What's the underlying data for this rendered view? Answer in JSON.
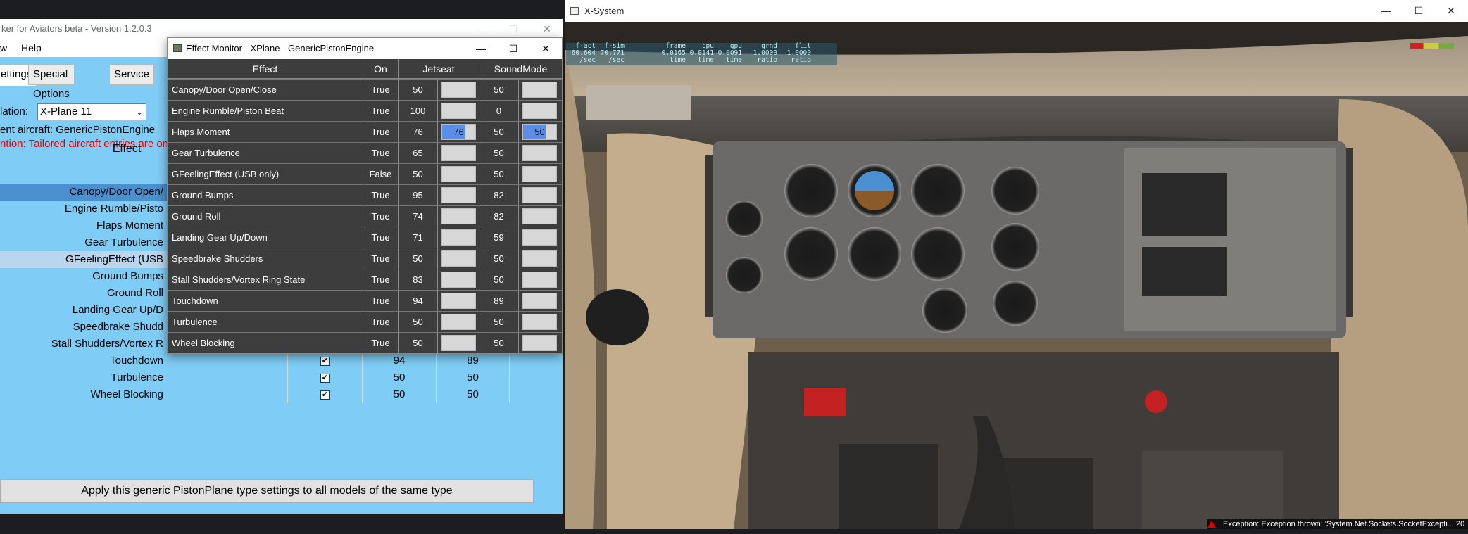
{
  "background_window": {
    "title": "ker for Aviators beta  - Version 1.2.0.3",
    "menu": [
      "w",
      "Help"
    ],
    "tabs": [
      "ettings",
      "Special Options",
      "Service"
    ],
    "sim_label": "lation:",
    "sim_value": "X-Plane 11",
    "aircraft_label": "ent aircraft: GenericPistonEngine",
    "notice": "ntion: Tailored aircraft entries are onl",
    "effect_header": "Effect",
    "rows": [
      {
        "name": "Canopy/Door Open/",
        "on": "",
        "j": "",
        "s": ""
      },
      {
        "name": "Engine Rumble/Pisto",
        "on": "",
        "j": "",
        "s": ""
      },
      {
        "name": "Flaps Moment",
        "on": "",
        "j": "",
        "s": ""
      },
      {
        "name": "Gear Turbulence",
        "on": "",
        "j": "",
        "s": ""
      },
      {
        "name": "GFeelingEffect (USB",
        "on": "",
        "j": "",
        "s": ""
      },
      {
        "name": "Ground Bumps",
        "on": "",
        "j": "",
        "s": ""
      },
      {
        "name": "Ground Roll",
        "on": "",
        "j": "",
        "s": ""
      },
      {
        "name": "Landing Gear Up/D",
        "on": "",
        "j": "",
        "s": ""
      },
      {
        "name": "Speedbrake Shudd",
        "on": "",
        "j": "",
        "s": ""
      },
      {
        "name": "Stall Shudders/Vortex R",
        "on": "",
        "j": "",
        "s": ""
      },
      {
        "name": "Touchdown",
        "on": "✔",
        "j": "94",
        "s": "89"
      },
      {
        "name": "Turbulence",
        "on": "✔",
        "j": "50",
        "s": "50"
      },
      {
        "name": "Wheel Blocking",
        "on": "✔",
        "j": "50",
        "s": "50"
      }
    ],
    "apply_label": "Apply this generic PistonPlane type settings to all models of the same type"
  },
  "effect_monitor": {
    "title": "Effect Monitor - XPlane - GenericPistonEngine",
    "headers": {
      "effect": "Effect",
      "on": "On",
      "jetseat": "Jetseat",
      "soundmode": "SoundMode"
    },
    "rows": [
      {
        "effect": "Canopy/Door Open/Close",
        "on": "True",
        "jetseat": "50",
        "jetseat_bar": "",
        "sound": "50",
        "sound_bar": ""
      },
      {
        "effect": "Engine Rumble/Piston Beat",
        "on": "True",
        "jetseat": "100",
        "jetseat_bar": "",
        "sound": "0",
        "sound_bar": ""
      },
      {
        "effect": "Flaps Moment",
        "on": "True",
        "jetseat": "76",
        "jetseat_bar": "76",
        "sound": "50",
        "sound_bar": "50"
      },
      {
        "effect": "Gear Turbulence",
        "on": "True",
        "jetseat": "65",
        "jetseat_bar": "",
        "sound": "50",
        "sound_bar": ""
      },
      {
        "effect": "GFeelingEffect (USB only)",
        "on": "False",
        "jetseat": "50",
        "jetseat_bar": "",
        "sound": "50",
        "sound_bar": ""
      },
      {
        "effect": "Ground Bumps",
        "on": "True",
        "jetseat": "95",
        "jetseat_bar": "",
        "sound": "82",
        "sound_bar": ""
      },
      {
        "effect": "Ground Roll",
        "on": "True",
        "jetseat": "74",
        "jetseat_bar": "",
        "sound": "82",
        "sound_bar": ""
      },
      {
        "effect": "Landing Gear Up/Down",
        "on": "True",
        "jetseat": "71",
        "jetseat_bar": "",
        "sound": "59",
        "sound_bar": ""
      },
      {
        "effect": "Speedbrake Shudders",
        "on": "True",
        "jetseat": "50",
        "jetseat_bar": "",
        "sound": "50",
        "sound_bar": ""
      },
      {
        "effect": "Stall Shudders/Vortex Ring State",
        "on": "True",
        "jetseat": "83",
        "jetseat_bar": "",
        "sound": "50",
        "sound_bar": ""
      },
      {
        "effect": "Touchdown",
        "on": "True",
        "jetseat": "94",
        "jetseat_bar": "",
        "sound": "89",
        "sound_bar": ""
      },
      {
        "effect": "Turbulence",
        "on": "True",
        "jetseat": "50",
        "jetseat_bar": "",
        "sound": "50",
        "sound_bar": ""
      },
      {
        "effect": "Wheel Blocking",
        "on": "True",
        "jetseat": "50",
        "jetseat_bar": "",
        "sound": "50",
        "sound_bar": ""
      }
    ]
  },
  "xsystem": {
    "title": "X-System",
    "stats": {
      "fact": "f-act",
      "fact_v": "60.604",
      "fact_u": "/sec",
      "fsim": "f-sim",
      "fsim_v": "70.771",
      "fsim_u": "/sec",
      "frame": "frame",
      "frame_v": "0.0165",
      "frame_u": "time",
      "cpu": "cpu",
      "cpu_v": "0.0141",
      "cpu_u": "time",
      "gpu": "gpu",
      "gpu_v": "0.0091",
      "gpu_u": "time",
      "grnd": "grnd",
      "grnd_v": "1.0000",
      "grnd_u": "ratio",
      "flit": "flit",
      "flit_v": "1.0000",
      "flit_u": "ratio"
    },
    "warning": "Exception: Exception thrown: 'System.Net.Sockets.SocketExcepti... 20"
  },
  "colors": {
    "app_bg": "#7fcdf6",
    "monitor_bg": "#3d3d3d",
    "bar_active": "#5b8ee8",
    "row_selected": "#4a8fd0"
  }
}
